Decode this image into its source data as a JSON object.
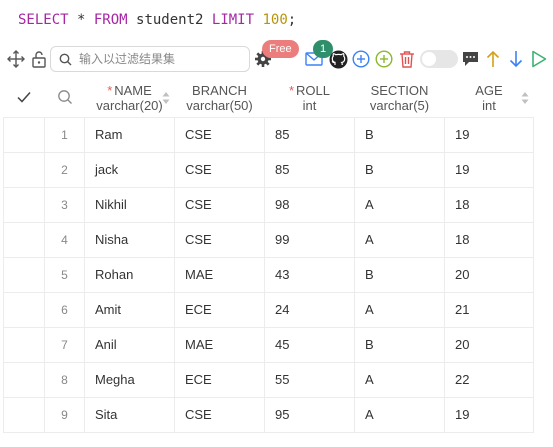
{
  "query": {
    "kw_select": "SELECT",
    "star": " * ",
    "kw_from": "FROM",
    "table": " student2 ",
    "kw_limit": "LIMIT",
    "space": " ",
    "limit": "100",
    "semicolon": ";"
  },
  "toolbar": {
    "search_placeholder": "输入以过滤结果集",
    "free_badge": "Free",
    "notification_count": "1",
    "icons": [
      "move-icon",
      "lock-icon",
      "search-icon",
      "gear-icon",
      "mail-icon",
      "github-icon",
      "add-circle-icon",
      "add-circle-outline-icon",
      "delete-icon",
      "toggle",
      "comment-icon",
      "arrow-up-icon",
      "arrow-down-icon",
      "play-icon"
    ],
    "colors": {
      "free_badge": "#ec7d7d",
      "count_badge": "#2f8f6b",
      "blue_icon": "#3b82f6",
      "green_icon": "#8bb82e",
      "red_icon": "#e05252",
      "play_icon": "#3cb371"
    }
  },
  "table": {
    "columns": [
      {
        "name": "NAME",
        "type": "varchar(20)",
        "required": true
      },
      {
        "name": "BRANCH",
        "type": "varchar(50)",
        "required": false
      },
      {
        "name": "ROLL",
        "type": "int",
        "required": true
      },
      {
        "name": "SECTION",
        "type": "varchar(5)",
        "required": false
      },
      {
        "name": "AGE",
        "type": "int",
        "required": false
      }
    ],
    "required_marker": "*",
    "rows": [
      {
        "num": "1",
        "name": "Ram",
        "branch": "CSE",
        "roll": "85",
        "section": "B",
        "age": "19"
      },
      {
        "num": "2",
        "name": "jack",
        "branch": "CSE",
        "roll": "85",
        "section": "B",
        "age": "19"
      },
      {
        "num": "3",
        "name": "Nikhil",
        "branch": "CSE",
        "roll": "98",
        "section": "A",
        "age": "18"
      },
      {
        "num": "4",
        "name": "Nisha",
        "branch": "CSE",
        "roll": "99",
        "section": "A",
        "age": "18"
      },
      {
        "num": "5",
        "name": "Rohan",
        "branch": "MAE",
        "roll": "43",
        "section": "B",
        "age": "20"
      },
      {
        "num": "6",
        "name": "Amit",
        "branch": "ECE",
        "roll": "24",
        "section": "A",
        "age": "21"
      },
      {
        "num": "7",
        "name": "Anil",
        "branch": "MAE",
        "roll": "45",
        "section": "B",
        "age": "20"
      },
      {
        "num": "8",
        "name": "Megha",
        "branch": "ECE",
        "roll": "55",
        "section": "A",
        "age": "22"
      },
      {
        "num": "9",
        "name": "Sita",
        "branch": "CSE",
        "roll": "95",
        "section": "A",
        "age": "19"
      }
    ]
  }
}
